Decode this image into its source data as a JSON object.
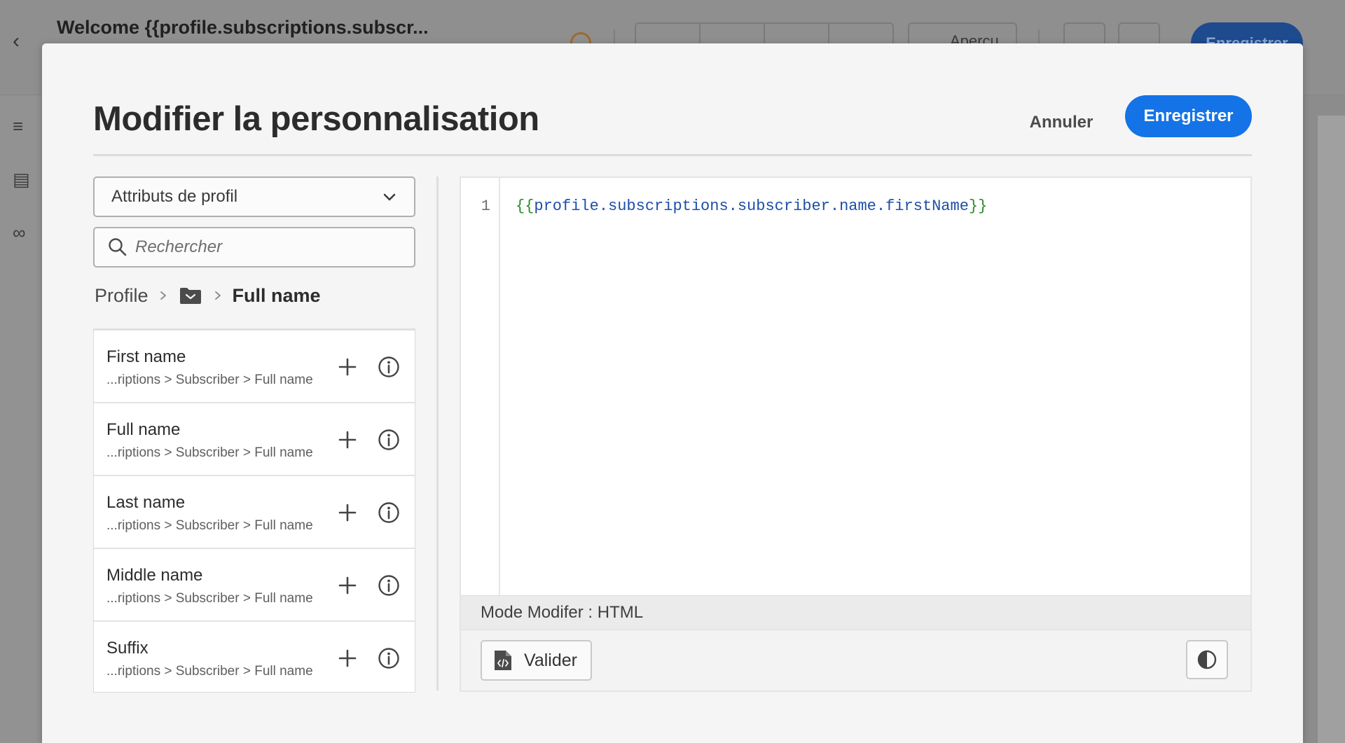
{
  "background": {
    "title": "Welcome {{profile.subscriptions.subscr...",
    "preview_label": "Aperçu",
    "save_label": "Enregistrer"
  },
  "dialog": {
    "title": "Modifier la personnalisation",
    "cancel_label": "Annuler",
    "save_label": "Enregistrer"
  },
  "sidebar": {
    "dropdown_value": "Attributs de profil",
    "search_placeholder": "Rechercher",
    "breadcrumb": {
      "root": "Profile",
      "folder_icon": "folder-icon",
      "current": "Full name"
    },
    "items": [
      {
        "name": "First name",
        "path": "...riptions > Subscriber > Full name"
      },
      {
        "name": "Full name",
        "path": "...riptions > Subscriber > Full name"
      },
      {
        "name": "Last name",
        "path": "...riptions > Subscriber > Full name"
      },
      {
        "name": "Middle name",
        "path": "...riptions > Subscriber > Full name"
      },
      {
        "name": "Suffix",
        "path": "...riptions > Subscriber > Full name"
      }
    ]
  },
  "editor": {
    "line_number": "1",
    "code_open": "{{",
    "code_expr": "profile.subscriptions.subscriber.name.firstName",
    "code_close": "}}",
    "mode_text": "Mode Modifer : HTML",
    "validate_label": "Valider"
  },
  "colors": {
    "accent": "#1473e6",
    "code_brace": "#2a8a2a",
    "code_expression": "#1d4fa8"
  }
}
